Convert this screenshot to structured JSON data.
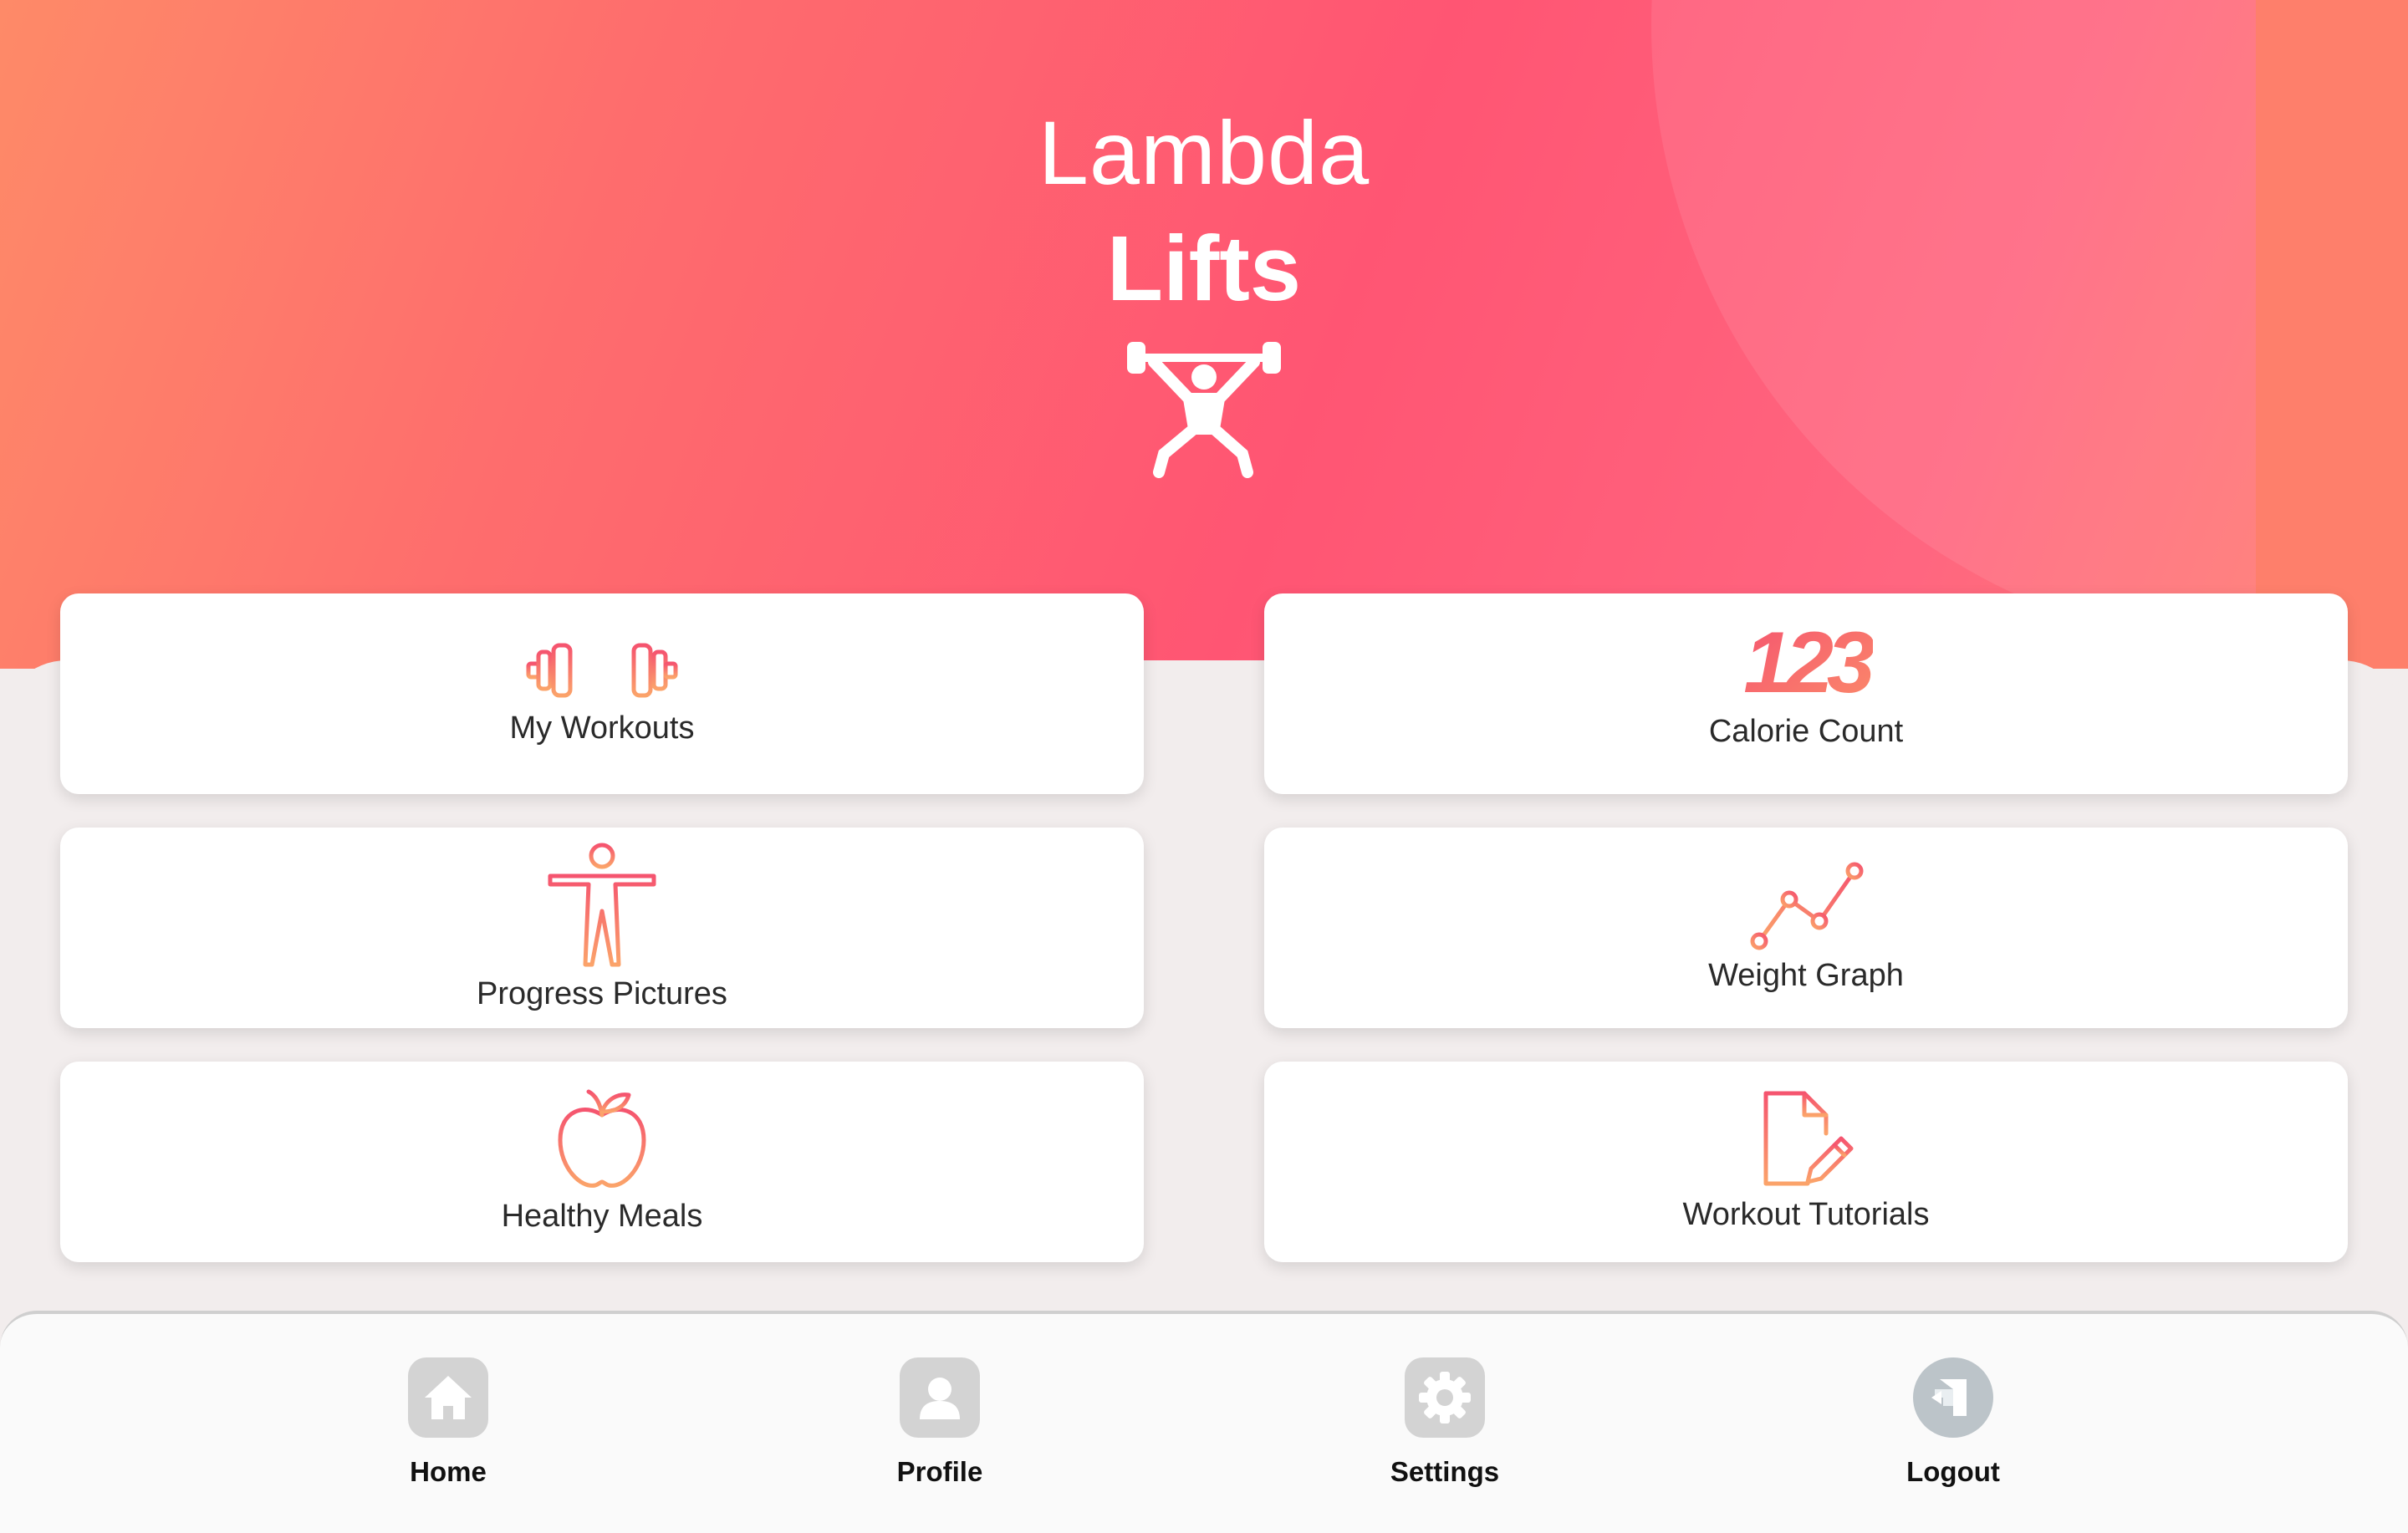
{
  "brand": {
    "line1": "Lambda",
    "line2": "Lifts",
    "icon": "weightlifter-icon"
  },
  "tiles": [
    {
      "label": "My Workouts",
      "icon": "dumbbell-icon"
    },
    {
      "label": "Calorie Count",
      "icon": "numbers-123-icon"
    },
    {
      "label": "Progress Pictures",
      "icon": "body-figure-icon"
    },
    {
      "label": "Weight Graph",
      "icon": "line-graph-icon"
    },
    {
      "label": "Healthy Meals",
      "icon": "apple-icon"
    },
    {
      "label": "Workout Tutorials",
      "icon": "document-edit-icon"
    }
  ],
  "calorie_icon_text": "123",
  "tabbar": [
    {
      "label": "Home",
      "icon": "home-icon"
    },
    {
      "label": "Profile",
      "icon": "profile-icon"
    },
    {
      "label": "Settings",
      "icon": "gear-icon"
    },
    {
      "label": "Logout",
      "icon": "logout-icon"
    }
  ],
  "colors": {
    "accent_start": "#ff5573",
    "accent_end": "#fe8a68",
    "icon_gradient_top": "#f5546f",
    "icon_gradient_bottom": "#fba36a",
    "tab_icon_gray": "#d3d3d3"
  }
}
